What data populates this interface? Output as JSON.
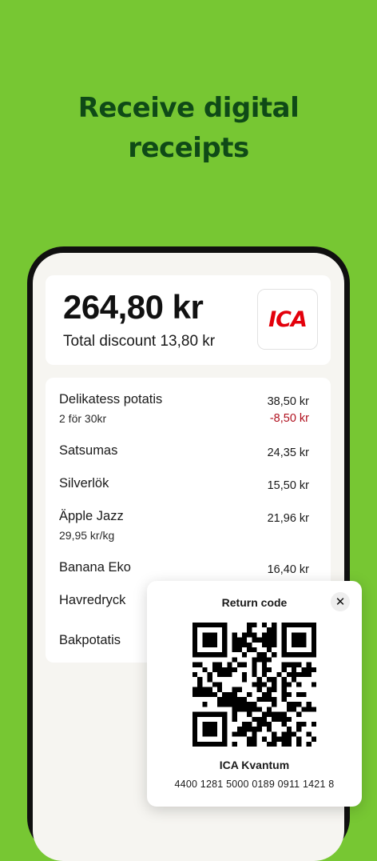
{
  "headline": {
    "line1": "Receive digital",
    "line2": "receipts"
  },
  "receipt": {
    "total": "264,80 kr",
    "total_discount": "Total discount 13,80 kr",
    "store_logo": "ICA",
    "brand_color": "#e3000b",
    "items": [
      {
        "name": "Delikatess potatis",
        "sub": "2 för 30kr",
        "price": "38,50 kr",
        "discount": "-8,50 kr"
      },
      {
        "name": "Satsumas",
        "sub": "",
        "price": "24,35 kr",
        "discount": ""
      },
      {
        "name": "Silverlök",
        "sub": "",
        "price": "15,50 kr",
        "discount": ""
      },
      {
        "name": "Äpple Jazz",
        "sub": "29,95 kr/kg",
        "price": "21,96 kr",
        "discount": ""
      },
      {
        "name": "Banana Eko",
        "sub": "",
        "price": "16,40 kr",
        "discount": ""
      },
      {
        "name": "Havredryck",
        "sub": "",
        "price": "",
        "discount": ""
      },
      {
        "name": "Bakpotatis",
        "sub": "",
        "price": "",
        "discount": ""
      }
    ]
  },
  "return_code": {
    "title": "Return code",
    "close_icon": "close-icon",
    "store": "ICA Kvantum",
    "code": "4400 1281 5000 0189 0911 1421 8"
  },
  "colors": {
    "background": "#77c733",
    "headline": "#0f4a17",
    "discount": "#b0101e"
  }
}
